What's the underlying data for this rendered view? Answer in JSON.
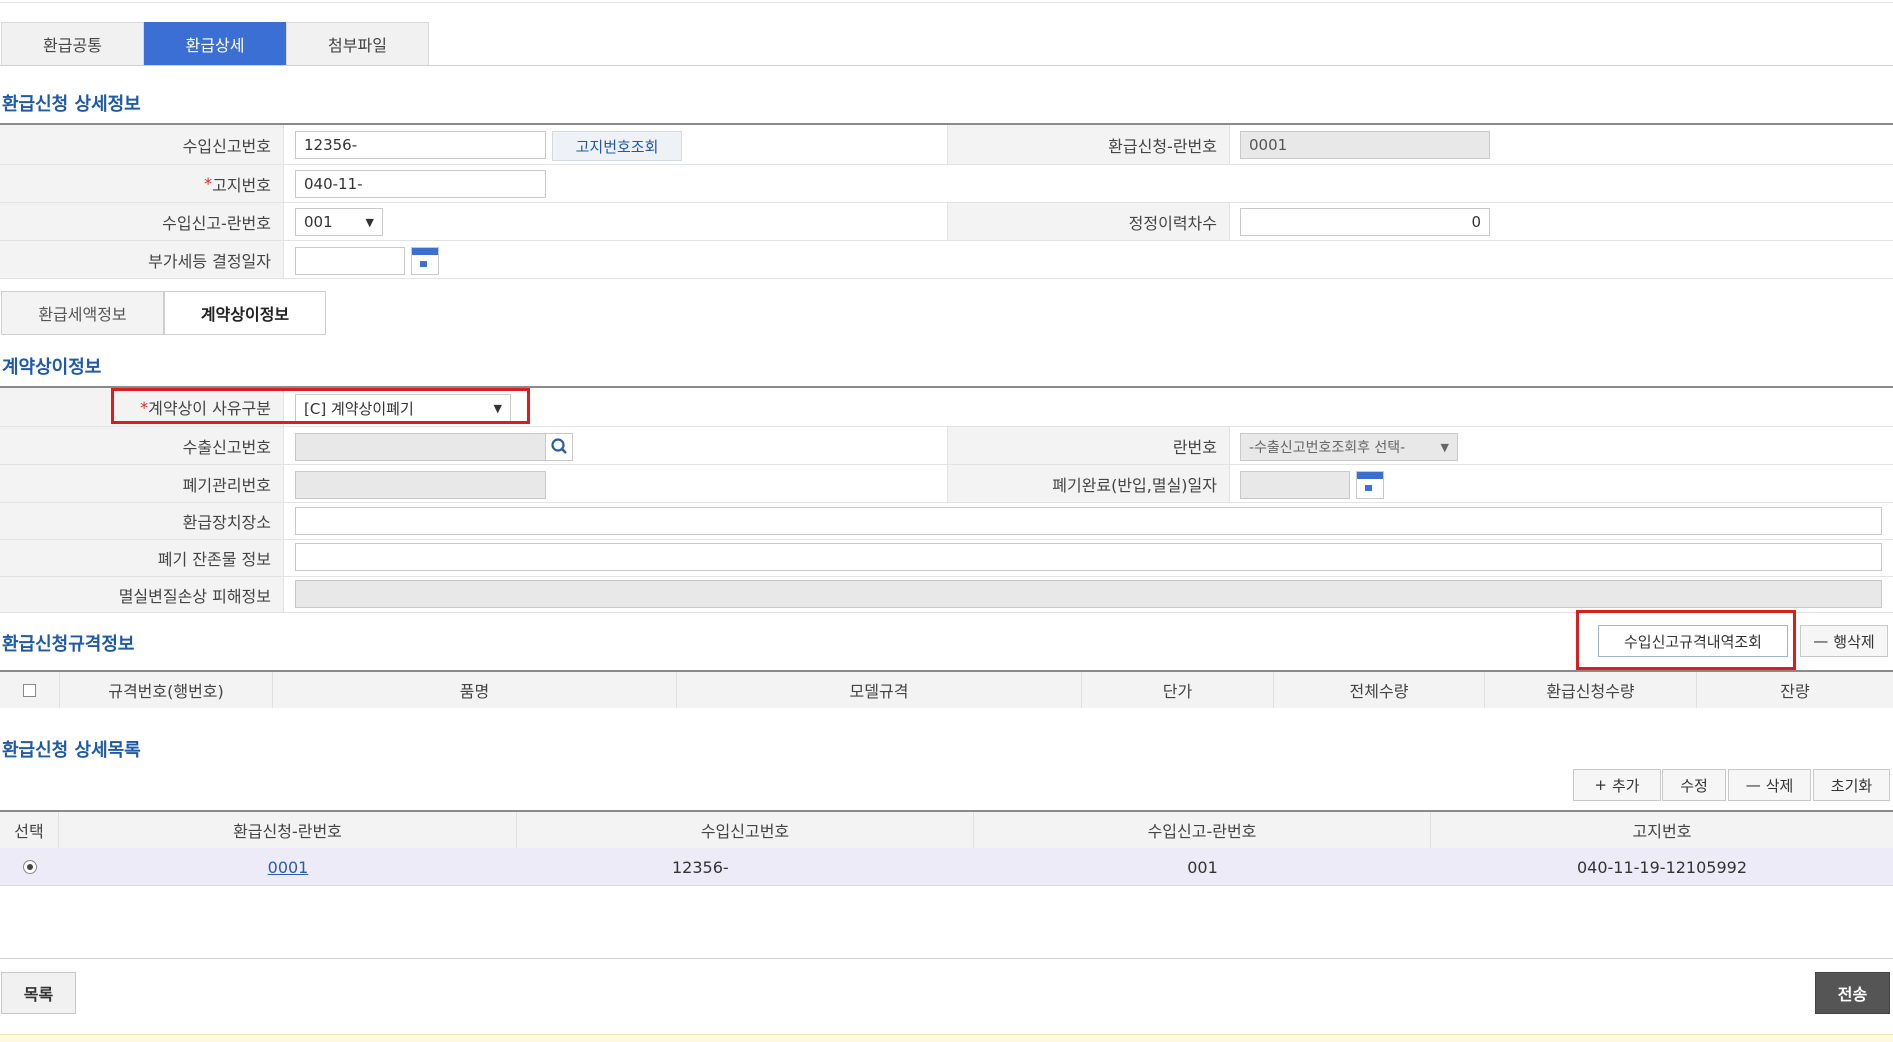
{
  "tabs": [
    "환급공통",
    "환급상세",
    "첨부파일"
  ],
  "sections": {
    "detail_info": "환급신청 상세정보",
    "contract_info": "계약상이정보",
    "spec_info": "환급신청규격정보",
    "detail_list": "환급신청 상세목록"
  },
  "detail": {
    "import_decl_no_label": "수입신고번호",
    "import_decl_no_value": "12356-",
    "lookup_notice_button": "고지번호조회",
    "refund_line_no_label": "환급신청-란번호",
    "refund_line_no_value": "0001",
    "notice_no_label": "고지번호",
    "notice_no_value": "040-11-",
    "import_line_no_label": "수입신고-란번호",
    "import_line_no_value": "001",
    "correction_seq_label": "정정이력차수",
    "correction_seq_value": "0",
    "vat_decision_date_label": "부가세등 결정일자",
    "vat_decision_date_value": ""
  },
  "subtabs": [
    "환급세액정보",
    "계약상이정보"
  ],
  "contract": {
    "reason_label": "계약상이 사유구분",
    "reason_value": "[C] 계약상이폐기",
    "export_decl_no_label": "수출신고번호",
    "line_no_label": "란번호",
    "line_no_value": "-수출신고번호조회후 선택-",
    "disposal_mgmt_no_label": "폐기관리번호",
    "disposal_done_date_label": "폐기완료(반입,멸실)일자",
    "storage_place_label": "환급장치장소",
    "residue_info_label": "폐기 잔존물 정보",
    "damage_info_label": "멸실변질손상 피해정보"
  },
  "spec": {
    "lookup_button": "수입신고규격내역조회",
    "delete_row_button": "행삭제",
    "columns": [
      "규격번호(행번호)",
      "품명",
      "모델규격",
      "단가",
      "전체수량",
      "환급신청수량",
      "잔량"
    ]
  },
  "list": {
    "buttons": {
      "add": "추가",
      "edit": "수정",
      "delete": "삭제",
      "reset": "초기화"
    },
    "columns": [
      "선택",
      "환급신청-란번호",
      "수입신고번호",
      "수입신고-란번호",
      "고지번호"
    ],
    "rows": [
      {
        "line_no": "0001",
        "import_decl_no": "12356-",
        "import_line_no": "001",
        "notice_no": "040-11-19-12105992"
      }
    ]
  },
  "footer": {
    "list_button": "목록",
    "send_button": "전송"
  }
}
